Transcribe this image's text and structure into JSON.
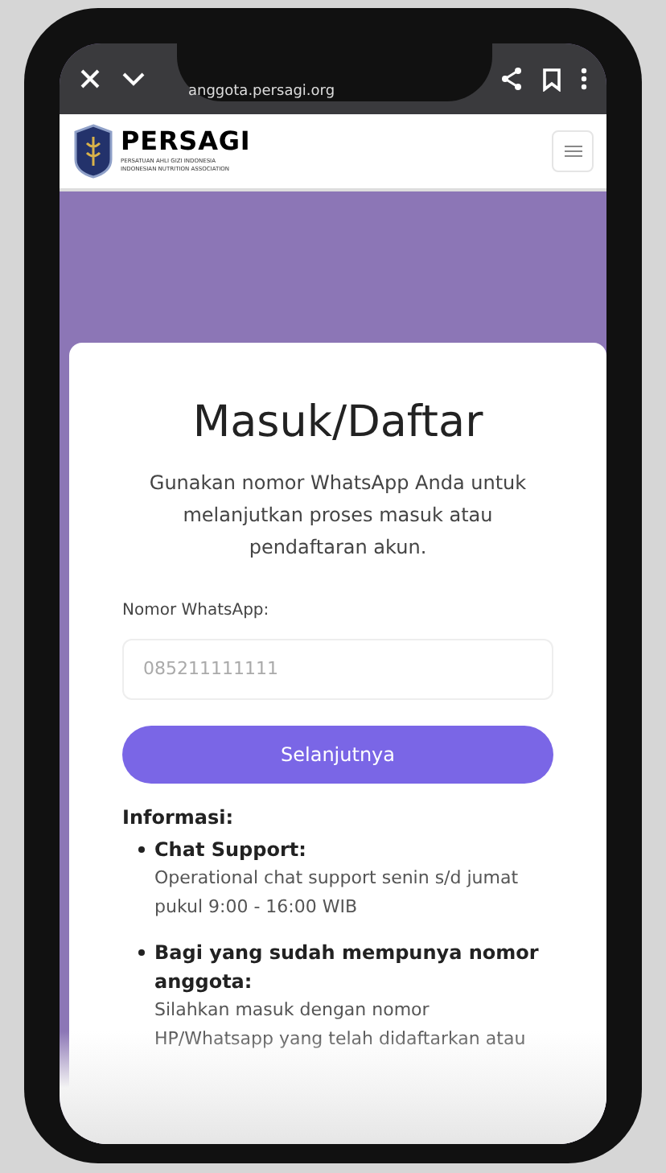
{
  "browser_bar": {
    "url": "anggota.persagi.org"
  },
  "header": {
    "brand": "PERSAGI",
    "tagline_lines": [
      "PERSATUAN AHLI GIZI INDONESIA",
      "INDONESIAN NUTRITION ASSOCIATION"
    ]
  },
  "card": {
    "title": "Masuk/Daftar",
    "subtitle": "Gunakan nomor WhatsApp Anda untuk melanjutkan proses masuk atau pendaftaran akun.",
    "field": {
      "label": "Nomor WhatsApp:",
      "placeholder": "085211111111"
    },
    "button": "Selanjutnya",
    "info": {
      "heading": "Informasi:",
      "items": [
        {
          "title": "Chat Support:",
          "text": "Operational chat support senin s/d jumat pukul 9:00 - 16:00 WIB"
        },
        {
          "title": "Bagi yang sudah mempunya nomor anggota:",
          "text": "Silahkan masuk dengan nomor HP/Whatsapp yang telah didaftarkan atau"
        }
      ]
    }
  }
}
